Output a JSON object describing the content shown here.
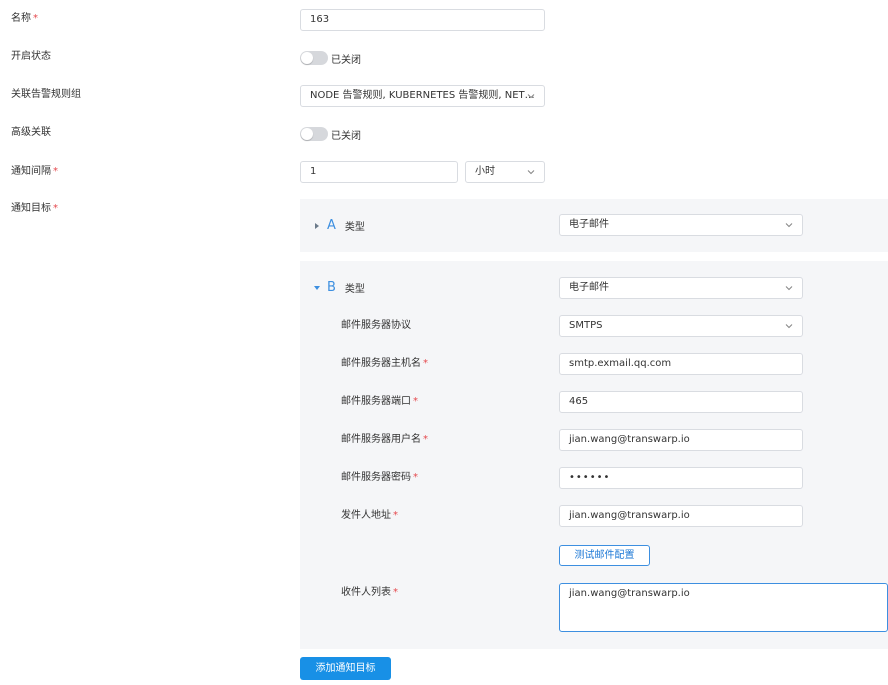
{
  "form": {
    "name_label": "名称",
    "name_value": "163",
    "enabled_label": "开启状态",
    "enabled_state_text": "已关闭",
    "rule_group_label": "关联告警规则组",
    "rule_group_value": "NODE 告警规则, KUBERNETES 告警规则, NET…",
    "advanced_label": "高级关联",
    "advanced_state_text": "已关闭",
    "interval_label": "通知间隔",
    "interval_value": "1",
    "interval_unit": "小时",
    "targets_label": "通知目标",
    "required_mark": "*"
  },
  "targets": [
    {
      "letter": "A",
      "expanded": false,
      "type_label": "类型",
      "type_value": "电子邮件"
    },
    {
      "letter": "B",
      "expanded": true,
      "type_label": "类型",
      "type_value": "电子邮件",
      "protocol_label": "邮件服务器协议",
      "protocol_value": "SMTPS",
      "host_label": "邮件服务器主机名",
      "host_value": "smtp.exmail.qq.com",
      "port_label": "邮件服务器端口",
      "port_value": "465",
      "user_label": "邮件服务器用户名",
      "user_value": "jian.wang@transwarp.io",
      "password_label": "邮件服务器密码",
      "password_value": "••••••",
      "sender_label": "发件人地址",
      "sender_value": "jian.wang@transwarp.io",
      "test_button": "测试邮件配置",
      "recipients_label": "收件人列表",
      "recipients_value": "jian.wang@transwarp.io"
    }
  ],
  "add_target_button": "添加通知目标",
  "icons": {
    "chevron": "chevron-down-icon",
    "caret_collapsed": "caret-right-icon",
    "caret_expanded": "caret-down-icon"
  },
  "colors": {
    "accent": "#1890e6",
    "required": "#e5484d",
    "panel_bg": "#f5f6f8",
    "border": "#d9dce1"
  }
}
